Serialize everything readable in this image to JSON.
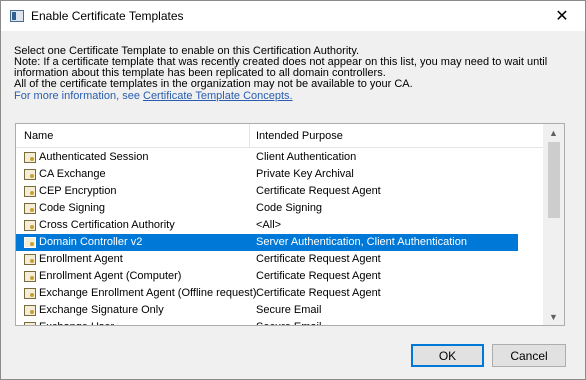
{
  "window": {
    "title": "Enable Certificate Templates",
    "close_glyph": "✕"
  },
  "intro": {
    "line1": "Select one Certificate Template to enable on this Certification Authority.",
    "line2": "Note: If a certificate template that was recently created does not appear on this list, you may need to wait until",
    "line3": "information about this template has been replicated to all domain controllers.",
    "line4": "All of the certificate templates in the organization may not be available to your CA.",
    "link_prefix": "For more information, see ",
    "link_text": "Certificate Template Concepts.",
    "link_color": "#2a5db0"
  },
  "list": {
    "columns": {
      "name": "Name",
      "purpose": "Intended Purpose"
    },
    "selected_color": "#0078d7",
    "rows": [
      {
        "name": "Authenticated Session",
        "purpose": "Client Authentication"
      },
      {
        "name": "CA Exchange",
        "purpose": "Private Key Archival"
      },
      {
        "name": "CEP Encryption",
        "purpose": "Certificate Request Agent"
      },
      {
        "name": "Code Signing",
        "purpose": "Code Signing"
      },
      {
        "name": "Cross Certification Authority",
        "purpose": "<All>"
      },
      {
        "name": "Domain Controller v2",
        "purpose": "Server Authentication, Client Authentication",
        "selected": true
      },
      {
        "name": "Enrollment Agent",
        "purpose": "Certificate Request Agent"
      },
      {
        "name": "Enrollment Agent (Computer)",
        "purpose": "Certificate Request Agent"
      },
      {
        "name": "Exchange Enrollment Agent (Offline request)",
        "purpose": "Certificate Request Agent"
      },
      {
        "name": "Exchange Signature Only",
        "purpose": "Secure Email"
      },
      {
        "name": "Exchange User",
        "purpose": "Secure Email"
      }
    ],
    "row_icon": "certificate-template-icon",
    "scroll_up_glyph": "▲",
    "scroll_down_glyph": "▼"
  },
  "buttons": {
    "ok": "OK",
    "cancel": "Cancel"
  }
}
